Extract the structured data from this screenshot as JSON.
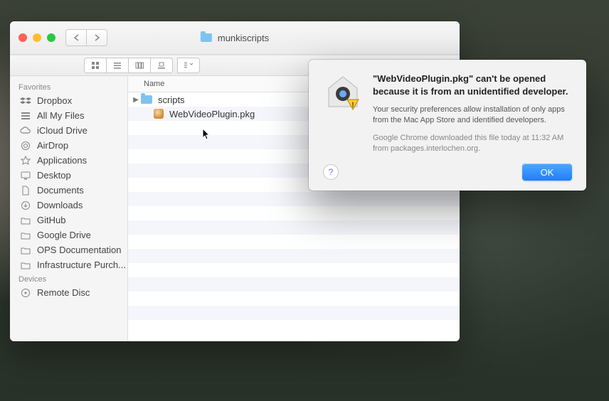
{
  "window": {
    "title": "munkiscripts",
    "viewmodes": [
      "icon",
      "list",
      "column",
      "coverflow"
    ]
  },
  "sidebar": {
    "favorites_label": "Favorites",
    "devices_label": "Devices",
    "favorites": [
      {
        "icon": "dropbox-icon",
        "label": "Dropbox"
      },
      {
        "icon": "allfiles-icon",
        "label": "All My Files"
      },
      {
        "icon": "icloud-icon",
        "label": "iCloud Drive"
      },
      {
        "icon": "airdrop-icon",
        "label": "AirDrop"
      },
      {
        "icon": "apps-icon",
        "label": "Applications"
      },
      {
        "icon": "desktop-icon",
        "label": "Desktop"
      },
      {
        "icon": "documents-icon",
        "label": "Documents"
      },
      {
        "icon": "downloads-icon",
        "label": "Downloads"
      },
      {
        "icon": "folder-icon",
        "label": "GitHub"
      },
      {
        "icon": "folder-icon",
        "label": "Google Drive"
      },
      {
        "icon": "folder-icon",
        "label": "OPS Documentation"
      },
      {
        "icon": "folder-icon",
        "label": "Infrastructure Purch..."
      }
    ],
    "devices": [
      {
        "icon": "disc-icon",
        "label": "Remote Disc"
      }
    ]
  },
  "list": {
    "name_header": "Name",
    "rows": [
      {
        "kind": "folder",
        "label": "scripts",
        "expandable": true
      },
      {
        "kind": "pkg",
        "label": "WebVideoPlugin.pkg",
        "expandable": false
      }
    ]
  },
  "alert": {
    "bold": "\"WebVideoPlugin.pkg\" can't be opened because it is from an unidentified developer.",
    "sub": "Your security preferences allow installation of only apps from the Mac App Store and identified developers.",
    "meta": "Google Chrome downloaded this file today at 11:32 AM from packages.interlochen.org.",
    "ok_label": "OK",
    "help_label": "?"
  }
}
